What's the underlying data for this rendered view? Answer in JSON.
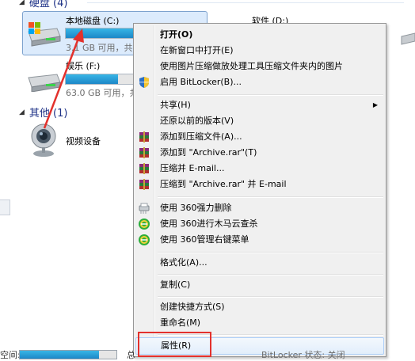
{
  "sections": {
    "hard_disks": "硬盘 (4)",
    "other": "其他 (1)"
  },
  "drives": [
    {
      "name": "本地磁盘 (C:)",
      "free": "3.1 GB 可用，共",
      "used_fraction": 0.72,
      "selected": true
    },
    {
      "name": "软件 (D:)"
    },
    {
      "name": "娱乐 (F:)",
      "free": "63.0 GB 可用，共",
      "used_fraction": 0.75
    }
  ],
  "devices": [
    {
      "name": "视频设备"
    }
  ],
  "menu": {
    "items": [
      {
        "label": "打开(O)",
        "bold": true
      },
      {
        "label": "在新窗口中打开(E)"
      },
      {
        "label": "使用图片压缩做放处理工具压缩文件夹内的图片"
      },
      {
        "label": "启用 BitLocker(B)...",
        "icon": "shield-icon"
      },
      {
        "label": "共享(H)",
        "submenu": true
      },
      {
        "label": "还原以前的版本(V)"
      },
      {
        "label": "添加到压缩文件(A)...",
        "icon": "winrar-icon"
      },
      {
        "label": "添加到 \"Archive.rar\"(T)",
        "icon": "winrar-icon"
      },
      {
        "label": "压缩并 E-mail...",
        "icon": "winrar-icon"
      },
      {
        "label": "压缩到 \"Archive.rar\" 并 E-mail",
        "icon": "winrar-icon"
      },
      {
        "label": "使用 360强力删除",
        "icon": "shredder-icon"
      },
      {
        "label": "使用 360进行木马云查杀",
        "icon": "360-icon"
      },
      {
        "label": "使用 360管理右键菜单",
        "icon": "360-icon"
      },
      {
        "label": "格式化(A)..."
      },
      {
        "label": "复制(C)"
      },
      {
        "label": "创建快捷方式(S)"
      },
      {
        "label": "重命名(M)"
      },
      {
        "label": "属性(R)",
        "highlighted": true
      }
    ]
  },
  "status": {
    "left": "空间:",
    "mid": "总",
    "right": "BitLocker 状态: 关闭"
  },
  "colors": {
    "annotation": "#e3312c",
    "selection": "#dcebfc",
    "bar_fill": "#26a0da"
  }
}
